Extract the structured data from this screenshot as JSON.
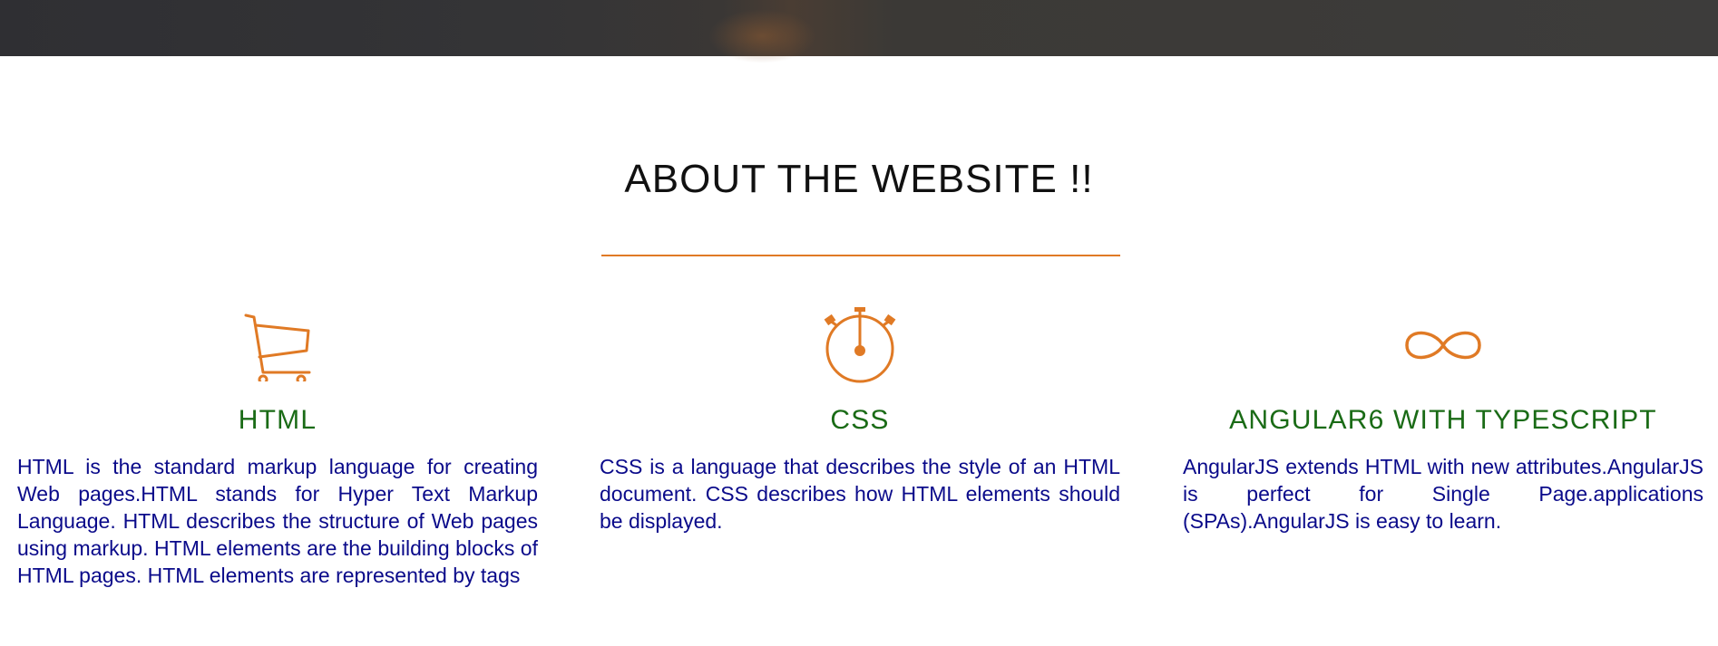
{
  "section": {
    "title": "ABOUT THE WEBSITE !!",
    "accent_color": "#e07a25",
    "heading_color": "#1a6b16",
    "body_color": "#0a0a8a"
  },
  "features": [
    {
      "icon": "shopping-cart-icon",
      "title": "HTML",
      "text": "HTML is the standard markup language for creating Web pages.HTML stands for Hyper Text Markup Language. HTML describes the structure of Web pages using markup. HTML elements are the building blocks of HTML pages. HTML elements are represented by tags"
    },
    {
      "icon": "stopwatch-icon",
      "title": "CSS",
      "text": "CSS is a language that describes the style of an HTML document. CSS describes how HTML elements should be displayed."
    },
    {
      "icon": "infinity-icon",
      "title": "ANGULAR6 WITH TYPESCRIPT",
      "text": "AngularJS extends HTML with new attributes.AngularJS is perfect for Single Page.applications (SPAs).AngularJS is easy to learn."
    }
  ]
}
